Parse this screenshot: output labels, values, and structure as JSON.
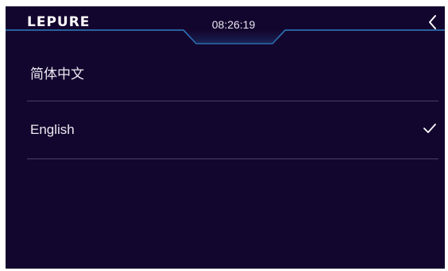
{
  "header": {
    "logo_text": "LEPURE",
    "time": "08:26:19",
    "back_icon": "chevron-left-icon"
  },
  "languages": [
    {
      "label": "简体中文",
      "selected": false
    },
    {
      "label": "English",
      "selected": true
    }
  ],
  "colors": {
    "background": "#13062e",
    "accent_line": "#2f7fc4",
    "divider": "#4a3f63",
    "text": "#eceaf2"
  },
  "icons": {
    "selected": "checkmark-icon"
  }
}
